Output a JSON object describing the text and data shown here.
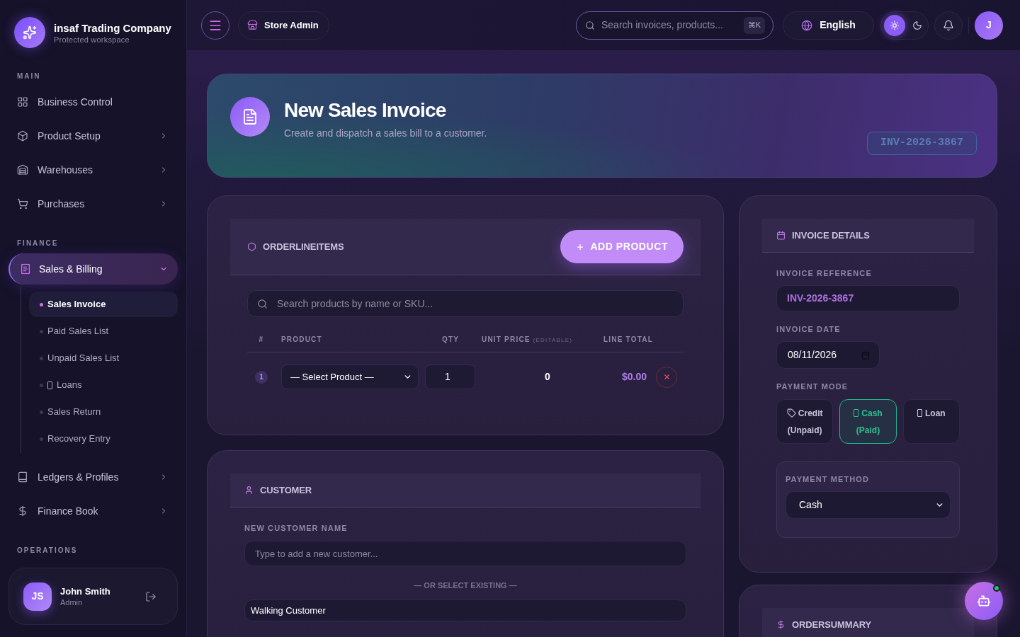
{
  "brand": {
    "name": "insaf Trading Company",
    "tagline": "Protected workspace"
  },
  "sidebar": {
    "sections": [
      {
        "label": "MAIN",
        "items": [
          {
            "label": "Business Control",
            "kind": "link",
            "selected": false
          },
          {
            "label": "Product Setup",
            "kind": "group",
            "selected": false,
            "expanded": false
          },
          {
            "label": "Warehouses",
            "kind": "group",
            "selected": false,
            "expanded": false
          },
          {
            "label": "Purchases",
            "kind": "group",
            "selected": false,
            "expanded": false
          }
        ]
      },
      {
        "label": "FINANCE",
        "items": [
          {
            "label": "Sales & Billing",
            "kind": "group",
            "selected": true,
            "expanded": true,
            "children": [
              {
                "label": "Sales Invoice",
                "selected": true
              },
              {
                "label": "Paid Sales List",
                "selected": false
              },
              {
                "label": "Unpaid Sales List",
                "selected": false
              },
              {
                "label": "Loans",
                "selected": false
              },
              {
                "label": "Sales Return",
                "selected": false
              },
              {
                "label": "Recovery Entry",
                "selected": false
              }
            ]
          },
          {
            "label": "Ledgers & Profiles",
            "kind": "group",
            "selected": false,
            "expanded": false
          },
          {
            "label": "Finance Book",
            "kind": "group",
            "selected": false,
            "expanded": false
          }
        ]
      },
      {
        "label": "OPERATIONS"
      }
    ]
  },
  "user": {
    "initials": "JS",
    "name": "John Smith",
    "role": "Admin"
  },
  "topbar": {
    "workspace": "Store Admin",
    "search": {
      "placeholder": "Search invoices, products...",
      "shortcut": "⌘K"
    },
    "language": "English",
    "theme_options": [
      {
        "kind": "light",
        "selected": true
      },
      {
        "kind": "dark",
        "selected": false
      }
    ],
    "avatar": "J"
  },
  "hero": {
    "title": "New Sales Invoice",
    "subtitle": "Create and dispatch a sales bill to a customer.",
    "invoice_number": "INV-2026-3867"
  },
  "order_items": {
    "title": "ORDERLINEITEMS",
    "add_button": "ADD PRODUCT",
    "search": {
      "placeholder": "Search products by name or SKU..."
    },
    "columns": [
      {
        "label": "#"
      },
      {
        "label": "PRODUCT"
      },
      {
        "label": "QTY"
      },
      {
        "label": "UNIT PRICE",
        "note": "(EDITABLE)"
      },
      {
        "label": "LINE TOTAL"
      }
    ],
    "rows": [
      {
        "number": "1",
        "product": "— Select Product —",
        "qty": "1",
        "unit_price": "0",
        "line_total": "$0.00"
      }
    ]
  },
  "customer": {
    "title": "CUSTOMER",
    "new_name": {
      "label": "NEW CUSTOMER NAME",
      "placeholder": "Type to add a new customer..."
    },
    "divider": "— OR SELECT EXISTING —",
    "existing": "Walking Customer"
  },
  "invoice_details": {
    "title": "INVOICE DETAILS",
    "reference": {
      "label": "INVOICE REFERENCE",
      "value": "INV-2026-3867"
    },
    "date": {
      "label": "INVOICE DATE",
      "value": "08/11/2026"
    },
    "payment_mode": {
      "label": "PAYMENT MODE",
      "options": [
        {
          "label": "Credit (Unpaid)",
          "selected": false
        },
        {
          "label": "Cash (Paid)",
          "selected": true
        },
        {
          "label": "Loan",
          "selected": false
        }
      ]
    },
    "payment_method": {
      "label": "PAYMENT METHOD",
      "value": "Cash"
    }
  },
  "order_summary": {
    "title": "ORDERSUMMARY"
  },
  "assistant": {
    "online": true
  }
}
